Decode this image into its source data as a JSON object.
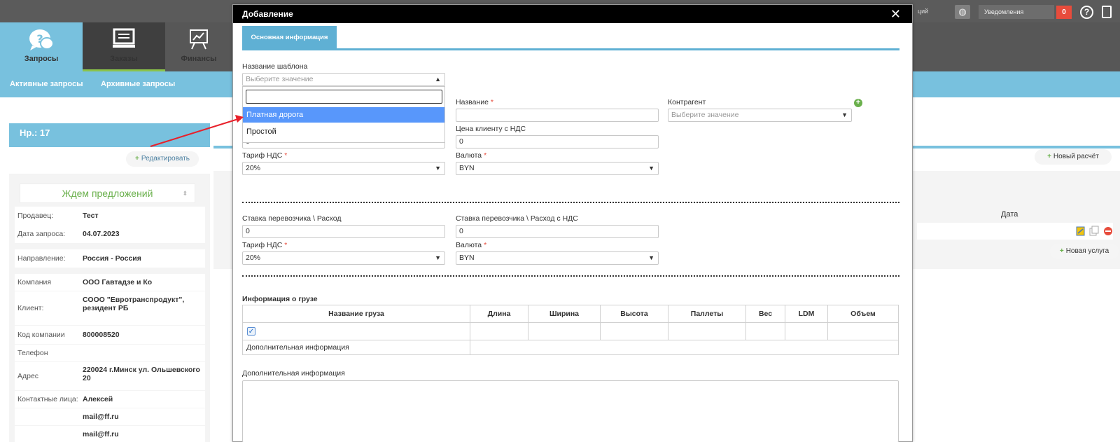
{
  "topbar": {
    "partial_text": "ций",
    "notifications_label": "Уведомления",
    "notifications_count": "0"
  },
  "nav": {
    "items": [
      {
        "label": "Запросы",
        "icon": "question-chat-icon"
      },
      {
        "label": "Заказы",
        "icon": "monitor-icon"
      },
      {
        "label": "Финансы",
        "icon": "presentation-chart-icon"
      }
    ]
  },
  "subnav": {
    "active_requests": "Активные запросы",
    "archived_requests": "Архивные запросы"
  },
  "left": {
    "number_title": "Нр.: 17",
    "edit_label": "Редактировать",
    "status": "Ждем предложений",
    "rows": [
      {
        "key": "Продавец:",
        "value": "Тест"
      },
      {
        "key": "Дата запроса:",
        "value": "04.07.2023"
      },
      {
        "key": "Направление:",
        "value": "Россия - Россия"
      },
      {
        "key": "Компания",
        "value": "ООО Гавтадзе и Ко"
      },
      {
        "key": "Клиент:",
        "value": "СООО \"Евротранспродукт\", резидент РБ"
      },
      {
        "key": "Код компании",
        "value": "800008520"
      },
      {
        "key": "Телефон",
        "value": ""
      },
      {
        "key": "Адрес",
        "value": "220024 г.Минск ул. Ольшевского 20"
      },
      {
        "key": "Контактные лица:",
        "value": "Алексей"
      },
      {
        "key": "",
        "value": "mail@ff.ru"
      },
      {
        "key": "",
        "value": "mail@ff.ru"
      }
    ]
  },
  "right": {
    "new_calc_label": "Новый расчёт",
    "date_header": "Дата",
    "new_service_label": "Новая услуга"
  },
  "modal": {
    "title": "Добавление",
    "tab_label": "Основная информация",
    "template_label": "Название шаблона",
    "template_placeholder": "Выберите значение",
    "dropdown_options": [
      "Платная дорога",
      "Простой"
    ],
    "name_label": "Название",
    "contractor_label": "Контрагент",
    "contractor_placeholder": "Выберите значение",
    "client_price_label": "Цена клиенту с НДС",
    "hidden_price_value": "0",
    "client_price_value": "0",
    "vat_label": "Тариф НДС",
    "vat_value": "20%",
    "currency_label": "Валюта",
    "currency_value": "BYN",
    "carrier_rate_label": "Ставка перевозчика \\ Расход",
    "carrier_rate_value": "0",
    "carrier_rate_vat_label": "Ставка перевозчика \\ Расход с НДС",
    "carrier_rate_vat_value": "0",
    "vat2_label": "Тариф НДС",
    "vat2_value": "20%",
    "currency2_label": "Валюта",
    "currency2_value": "BYN",
    "cargo_section_title": "Информация о грузе",
    "cargo_columns": [
      "Название груза",
      "Длина",
      "Ширина",
      "Высота",
      "Паллеты",
      "Вес",
      "LDM",
      "Объем"
    ],
    "cargo_addl_label": "Дополнительная информация",
    "addl_info_label": "Дополнительная информация",
    "required_mark": "*"
  },
  "colors": {
    "accent_blue": "#78c1de",
    "highlight_option": "#5897fb",
    "status_green": "#6ab04c",
    "annotation_arrow": "#e8202a"
  }
}
